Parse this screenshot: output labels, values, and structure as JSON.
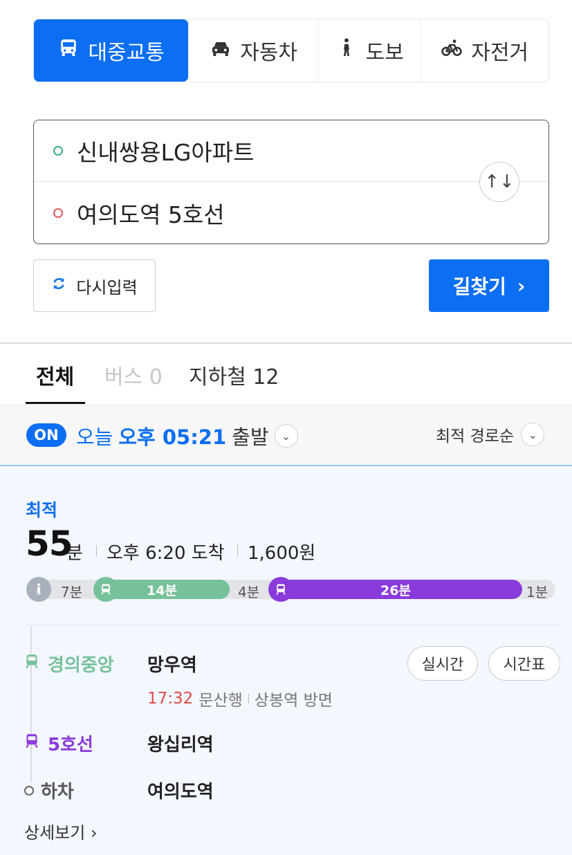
{
  "colors": {
    "accent": "#0c6ef2",
    "line_gyeongui": "#77c19a",
    "line_5": "#8a3bdb",
    "departure_time_red": "#e04848"
  },
  "mode_tabs": [
    {
      "label": "대중교통",
      "icon": "bus-icon",
      "active": true
    },
    {
      "label": "자동차",
      "icon": "car-icon",
      "active": false
    },
    {
      "label": "도보",
      "icon": "walk-icon",
      "active": false
    },
    {
      "label": "자전거",
      "icon": "bike-icon",
      "active": false
    }
  ],
  "route": {
    "origin": "신내쌍용LG아파트",
    "destination": "여의도역 5호선",
    "swap_icon": "↑↓"
  },
  "actions": {
    "reset_label": "다시입력",
    "search_label": "길찾기",
    "search_arrow": "›"
  },
  "filter_tabs": [
    {
      "label": "전체",
      "active": true
    },
    {
      "label": "버스 0",
      "disabled": true
    },
    {
      "label": "지하철 12",
      "active": false
    }
  ],
  "departure": {
    "badge": "ON",
    "day": "오늘",
    "time": "오후 05:21",
    "suffix": "출발",
    "sort_label": "최적 경로순"
  },
  "result": {
    "tag": "최적",
    "duration_value": "55",
    "duration_unit": "분",
    "arrival": "오후 6:20 도착",
    "fare": "1,600원",
    "segments": [
      {
        "type": "walk",
        "label": "7분"
      },
      {
        "type": "gyeongui",
        "label": "14분"
      },
      {
        "type": "walk",
        "label": "4분"
      },
      {
        "type": "line5",
        "label": "26분"
      },
      {
        "type": "walk",
        "label": "1분"
      }
    ],
    "steps": [
      {
        "line": "경의중앙",
        "station": "망우역",
        "time": "17:32",
        "direction": "문산행",
        "platform": "상봉역 방면",
        "realtime_label": "실시간",
        "timetable_label": "시간표"
      },
      {
        "line": "5호선",
        "station": "왕십리역"
      },
      {
        "line": "하차",
        "station": "여의도역"
      }
    ],
    "detail_label": "상세보기 ›"
  }
}
